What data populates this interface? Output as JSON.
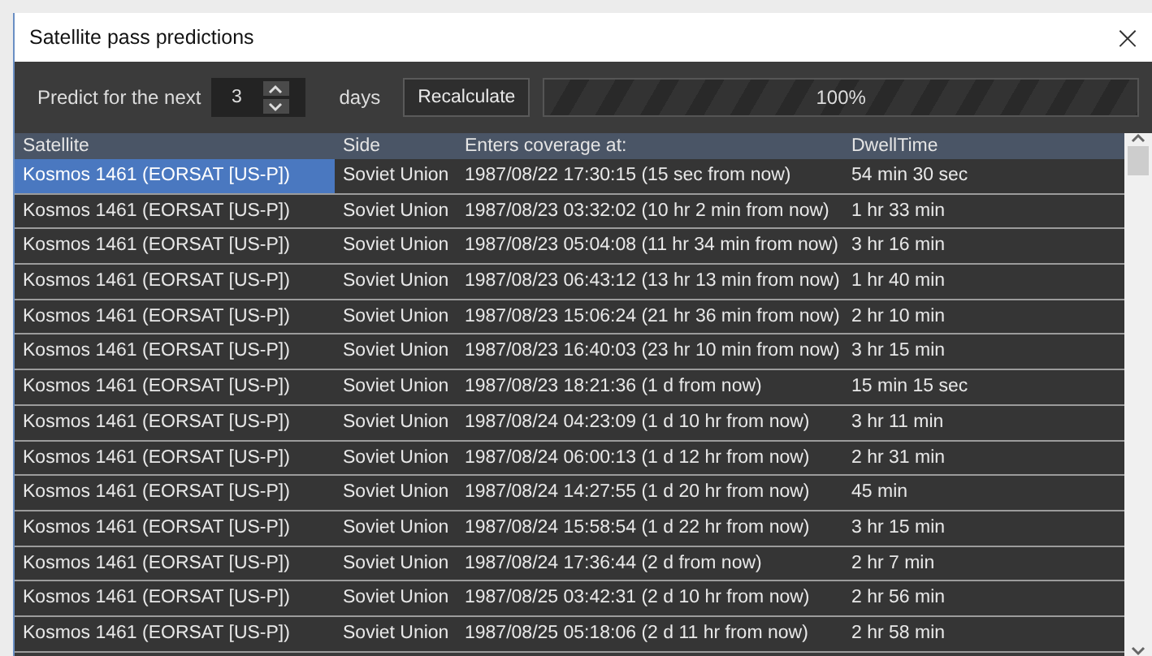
{
  "window": {
    "title": "Satellite pass predictions",
    "close": "×"
  },
  "toolbar": {
    "predict_label": "Predict for the next",
    "days_value": "3",
    "days_label": "days",
    "recalculate_button": "Recalculate",
    "progress": {
      "level": 1.0,
      "reading": "100%"
    }
  },
  "table": {
    "columns": [
      "Satellite",
      "Side",
      "Enters coverage at:",
      "DwellTime"
    ],
    "rows": [
      {
        "selected": true,
        "cells": [
          "Kosmos 1461 (EORSAT [US-P])",
          "Soviet Union",
          "1987/08/22 17:30:15 (15 sec from now)",
          "54 min 30 sec"
        ]
      },
      {
        "selected": false,
        "cells": [
          "Kosmos 1461 (EORSAT [US-P])",
          "Soviet Union",
          "1987/08/23 03:32:02 (10 hr 2 min from now)",
          "1 hr 33 min"
        ]
      },
      {
        "selected": false,
        "cells": [
          "Kosmos 1461 (EORSAT [US-P])",
          "Soviet Union",
          "1987/08/23 05:04:08 (11 hr 34 min from now)",
          "3 hr 16 min"
        ]
      },
      {
        "selected": false,
        "cells": [
          "Kosmos 1461 (EORSAT [US-P])",
          "Soviet Union",
          "1987/08/23 06:43:12 (13 hr 13 min from now)",
          "1 hr 40 min"
        ]
      },
      {
        "selected": false,
        "cells": [
          "Kosmos 1461 (EORSAT [US-P])",
          "Soviet Union",
          "1987/08/23 15:06:24 (21 hr 36 min from now)",
          "2 hr 10 min"
        ]
      },
      {
        "selected": false,
        "cells": [
          "Kosmos 1461 (EORSAT [US-P])",
          "Soviet Union",
          "1987/08/23 16:40:03 (23 hr 10 min from now)",
          "3 hr 15 min"
        ]
      },
      {
        "selected": false,
        "cells": [
          "Kosmos 1461 (EORSAT [US-P])",
          "Soviet Union",
          "1987/08/23 18:21:36 (1 d from now)",
          "15 min 15 sec"
        ]
      },
      {
        "selected": false,
        "cells": [
          "Kosmos 1461 (EORSAT [US-P])",
          "Soviet Union",
          "1987/08/24 04:23:09 (1 d 10 hr from now)",
          "3 hr 11 min"
        ]
      },
      {
        "selected": false,
        "cells": [
          "Kosmos 1461 (EORSAT [US-P])",
          "Soviet Union",
          "1987/08/24 06:00:13 (1 d 12 hr from now)",
          "2 hr 31 min"
        ]
      },
      {
        "selected": false,
        "cells": [
          "Kosmos 1461 (EORSAT [US-P])",
          "Soviet Union",
          "1987/08/24 14:27:55 (1 d 20 hr from now)",
          "45 min"
        ]
      },
      {
        "selected": false,
        "cells": [
          "Kosmos 1461 (EORSAT [US-P])",
          "Soviet Union",
          "1987/08/24 15:58:54 (1 d 22 hr from now)",
          "3 hr 15 min"
        ]
      },
      {
        "selected": false,
        "cells": [
          "Kosmos 1461 (EORSAT [US-P])",
          "Soviet Union",
          "1987/08/24 17:36:44 (2 d from now)",
          "2 hr 7 min"
        ]
      },
      {
        "selected": false,
        "cells": [
          "Kosmos 1461 (EORSAT [US-P])",
          "Soviet Union",
          "1987/08/25 03:42:31 (2 d 10 hr from now)",
          "2 hr 56 min"
        ]
      },
      {
        "selected": false,
        "cells": [
          "Kosmos 1461 (EORSAT [US-P])",
          "Soviet Union",
          "1987/08/25 05:18:06 (2 d 11 hr from now)",
          "2 hr 58 min"
        ]
      }
    ]
  }
}
